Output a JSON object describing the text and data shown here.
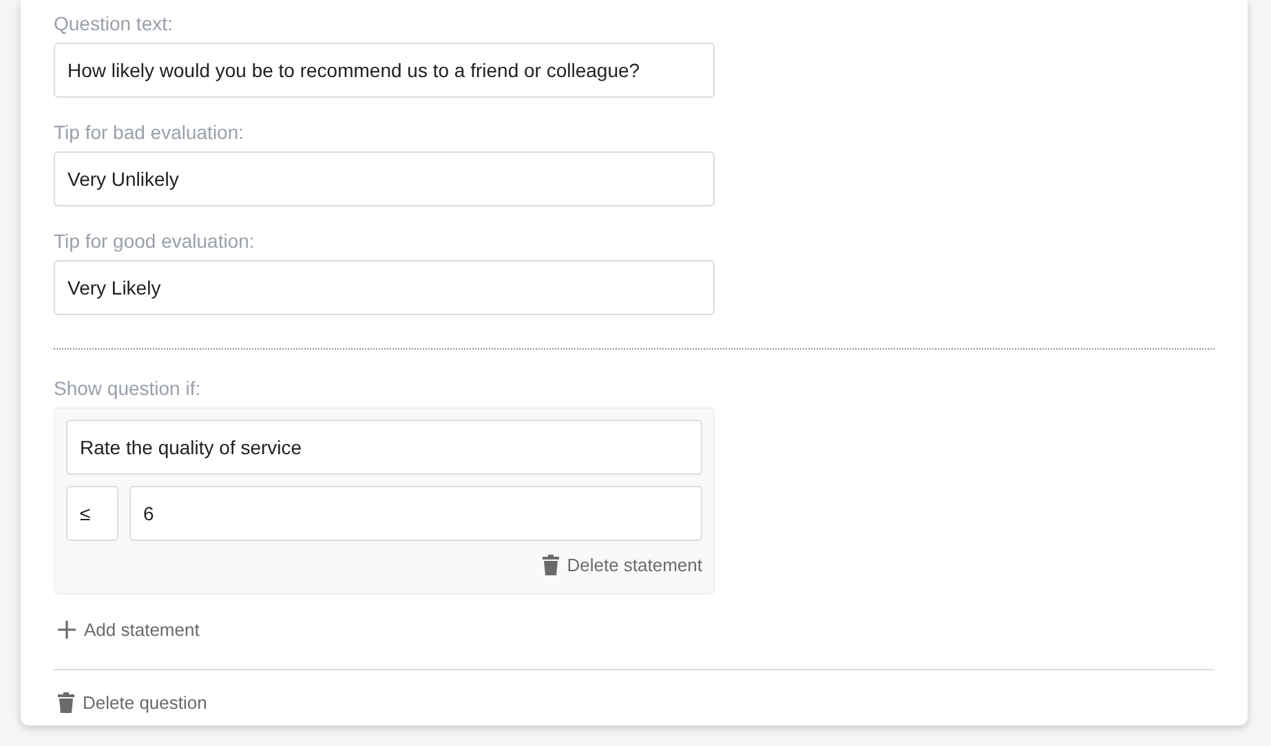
{
  "fields": [
    {
      "label": "Question text:",
      "value": "How likely would you be to recommend us to a friend or colleague?"
    },
    {
      "label": "Tip for bad evaluation:",
      "value": "Very Unlikely"
    },
    {
      "label": "Tip for good evaluation:",
      "value": "Very Likely"
    }
  ],
  "condition": {
    "label": "Show question if:",
    "statements": [
      {
        "question": "Rate the quality of service",
        "operator": "≤",
        "value": "6",
        "delete_label": "Delete statement"
      }
    ],
    "add_label": "Add statement"
  },
  "delete_question": "Delete question"
}
